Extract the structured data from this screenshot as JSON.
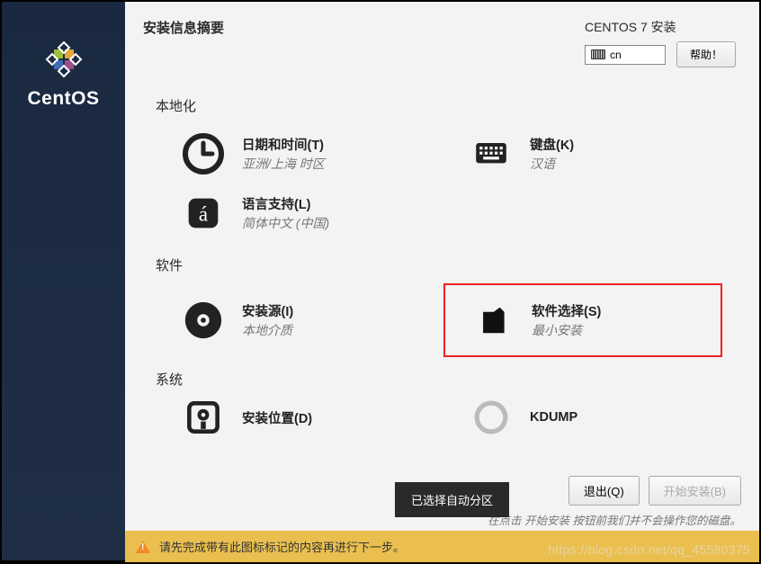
{
  "sidebar": {
    "brand": "CentOS"
  },
  "header": {
    "title": "安装信息摘要",
    "installer": "CENTOS 7 安装",
    "keyboard_code": "cn",
    "help_label": "帮助！"
  },
  "sections": {
    "localization": {
      "label": "本地化",
      "datetime": {
        "title": "日期和时间(T)",
        "sub": "亚洲/上海 时区"
      },
      "keyboard": {
        "title": "键盘(K)",
        "sub": "汉语"
      },
      "language": {
        "title": "语言支持(L)",
        "sub": "简体中文 (中国)"
      }
    },
    "software": {
      "label": "软件",
      "source": {
        "title": "安装源(I)",
        "sub": "本地介质"
      },
      "selection": {
        "title": "软件选择(S)",
        "sub": "最小安装"
      }
    },
    "system": {
      "label": "系统",
      "destination": {
        "title": "安装位置(D)"
      },
      "kdump": {
        "title": "KDUMP"
      }
    }
  },
  "tooltip": "已选择自动分区",
  "footer": {
    "quit_label": "退出(Q)",
    "begin_label": "开始安装(B)",
    "hint": "在点击 开始安装 按钮前我们并不会操作您的磁盘。"
  },
  "warning": "请先完成带有此图标标记的内容再进行下一步。",
  "watermark": "https://blog.csdn.net/qq_45580375"
}
